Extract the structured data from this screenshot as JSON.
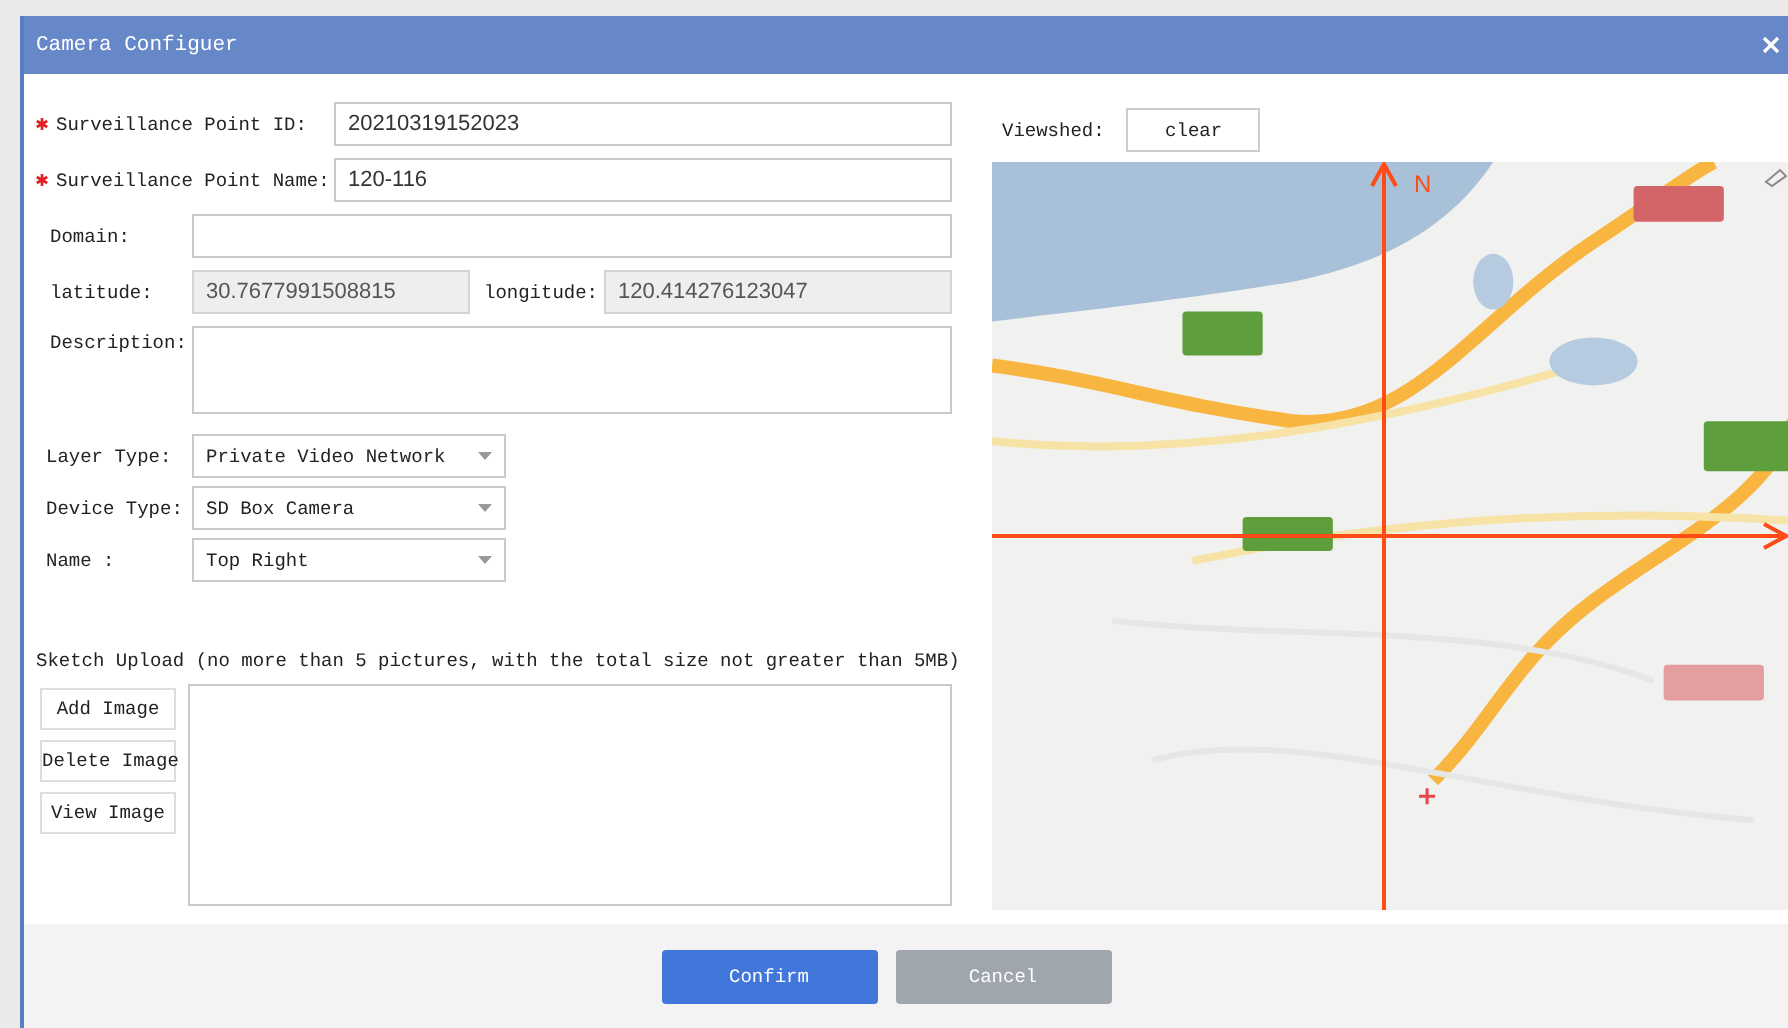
{
  "window": {
    "title": "Camera Configuer"
  },
  "rows": [
    {
      "kind": "text",
      "required": true,
      "label": "Surveillance Point ID:",
      "value": "20210319152023"
    },
    {
      "kind": "text",
      "required": true,
      "label": "Surveillance Point Name:",
      "value": "120-116"
    },
    {
      "kind": "text",
      "required": false,
      "label": "Domain:",
      "value": ""
    },
    {
      "kind": "pair",
      "fields": [
        {
          "label": "latitude:",
          "value": "30.7677991508815",
          "disabled": true
        },
        {
          "label": "longitude:",
          "value": "120.414276123047",
          "disabled": true
        }
      ]
    },
    {
      "kind": "textarea",
      "required": false,
      "label": "Description:",
      "value": ""
    },
    {
      "kind": "select",
      "label": "Layer Type:",
      "value": "Private Video Network"
    },
    {
      "kind": "select",
      "label": "Device Type:",
      "value": "SD Box Camera"
    },
    {
      "kind": "select",
      "label": "Name :",
      "value": "Top Right"
    }
  ],
  "sketch": {
    "label": "Sketch Upload (no more than 5 pictures, with the total size not greater than 5MB)",
    "buttons": [
      "Add Image",
      "Delete Image",
      "View Image"
    ]
  },
  "viewshed": {
    "label": "Viewshed:",
    "button": "clear"
  },
  "map": {
    "kind": "picture",
    "north": "N"
  },
  "footer": {
    "buttons": [
      {
        "label": "Confirm",
        "kind": "primary"
      },
      {
        "label": "Cancel",
        "kind": "secondary"
      }
    ]
  }
}
